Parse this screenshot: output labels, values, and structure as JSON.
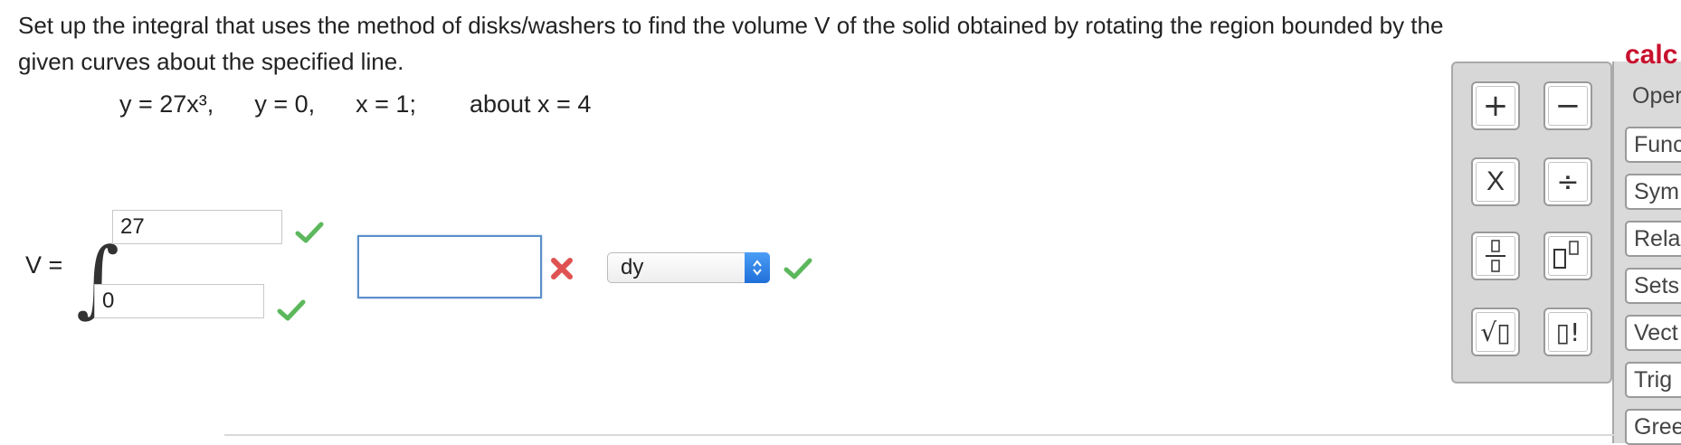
{
  "question": {
    "line1": "Set up the integral that uses the method of disks/washers to find the volume V of the solid obtained by rotating the region bounded by the",
    "line2": "given curves about the specified line."
  },
  "equation": {
    "curve1": "y = 27x³,",
    "curve2": "y = 0,",
    "curve3": "x = 1;",
    "axis": "about x = 4"
  },
  "answer": {
    "v_label": "V =",
    "upper_limit": "27",
    "lower_limit": "0",
    "integrand": "",
    "variable": "dy",
    "status": {
      "upper_limit": "correct",
      "lower_limit": "correct",
      "integrand": "incorrect",
      "variable": "correct"
    },
    "colors": {
      "correct": "#5cb85c",
      "incorrect": "#e05252",
      "focus_border": "#5b8ec9"
    }
  },
  "calculator": {
    "title": "calc",
    "keys": [
      {
        "name": "plus-key",
        "glyph": "+"
      },
      {
        "name": "minus-key",
        "glyph": "−"
      },
      {
        "name": "times-key",
        "glyph": "X"
      },
      {
        "name": "divide-key",
        "glyph": "÷"
      },
      {
        "name": "fraction-key",
        "glyph": "fraction"
      },
      {
        "name": "exponent-key",
        "glyph": "exponent"
      },
      {
        "name": "sqrt-key",
        "glyph": "√▯"
      },
      {
        "name": "factorial-key",
        "glyph": "▯!"
      }
    ],
    "categories": [
      "Oper",
      "Func",
      "Sym",
      "Rela",
      "Sets",
      "Vect",
      "Trig",
      "Gree"
    ],
    "title_color": "#c8102e"
  }
}
